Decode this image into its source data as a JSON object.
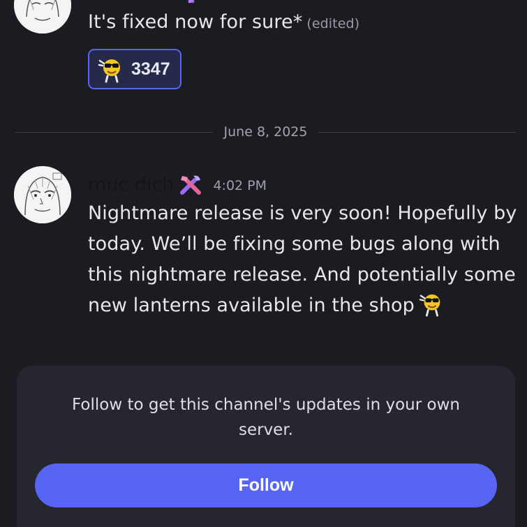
{
  "messages": [
    {
      "text": "It's fixed now for sure*",
      "edited_label": "(edited)",
      "reaction": {
        "emoji": "cool-sunglasses-emoji",
        "count": "3347"
      }
    }
  ],
  "divider": {
    "date": "June 8, 2025"
  },
  "post": {
    "author": "muc dich",
    "role_icon": "tools-icon",
    "time": "4:02 PM",
    "text": "Nightmare release is very soon! Hopefully by today. We’ll be fixing some bugs along with this nightmare release. And potentially some new lanterns available in the shop",
    "trailing_emoji": "cool-sunglasses-emoji"
  },
  "follow_card": {
    "info": "Follow to get this channel's updates in your own server.",
    "button_label": "Follow"
  },
  "colors": {
    "background": "#1b1c21",
    "card": "#26272e",
    "accent": "#5865f2",
    "reaction_bg": "#262a4a"
  }
}
